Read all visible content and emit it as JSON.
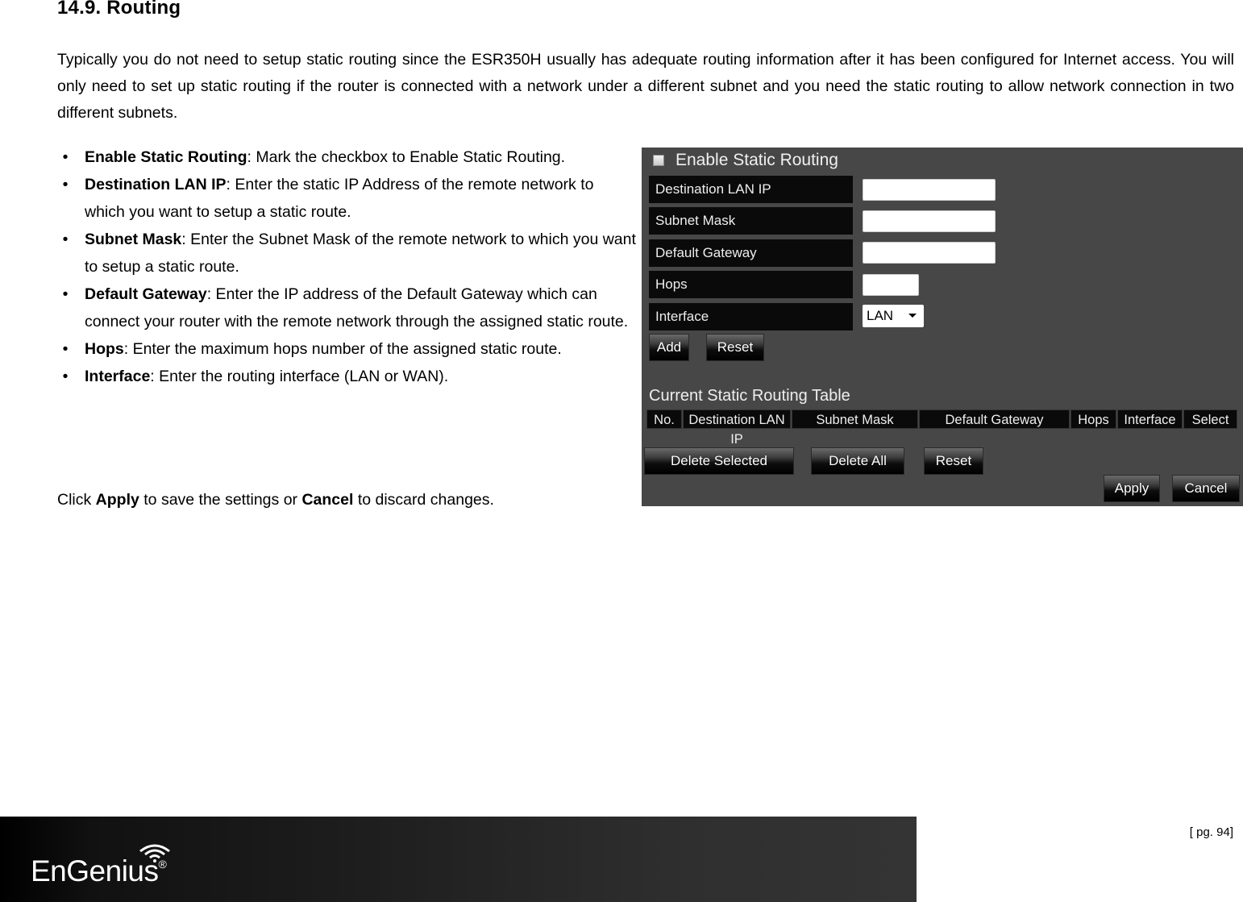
{
  "document": {
    "section_heading": "14.9.  Routing",
    "intro": "Typically you do not need to setup static routing since the ESR350H usually has adequate routing information after it has been configured for Internet access. You will only need to set up static routing if the router is connected with a network under a different subnet and you need the static routing to allow network connection in two different subnets.",
    "bullets": [
      {
        "term": "Enable Static Routing",
        "desc": ": Mark the checkbox to Enable Static Routing."
      },
      {
        "term": "Destination LAN IP",
        "desc": ": Enter the static IP Address of the remote network to which you want to setup a static route."
      },
      {
        "term": "Subnet Mask",
        "desc": ": Enter the Subnet Mask of the remote network to which you want to setup a static route."
      },
      {
        "term": "Default Gateway",
        "desc": ": Enter the IP address of the Default Gateway which can connect your router with the remote network through the assigned static route."
      },
      {
        "term": "Hops",
        "desc": ": Enter the maximum hops number of the assigned static route."
      },
      {
        "term": "Interface",
        "desc": ": Enter the routing interface (LAN or WAN)."
      }
    ],
    "closing": {
      "pre": "Click ",
      "apply": "Apply",
      "mid": " to save the settings or ",
      "cancel": "Cancel",
      "post": " to discard changes."
    },
    "bullet_glyph": "•"
  },
  "panel": {
    "enable_label": "Enable Static Routing",
    "enable_checked": false,
    "fields": [
      {
        "label": "Destination LAN IP",
        "value": ""
      },
      {
        "label": "Subnet Mask",
        "value": ""
      },
      {
        "label": "Default Gateway",
        "value": ""
      },
      {
        "label": "Hops",
        "value": ""
      }
    ],
    "interface": {
      "label": "Interface",
      "selected": "LAN"
    },
    "add_button": "Add",
    "reset_button": "Reset",
    "table_title": "Current Static Routing Table",
    "table_headers": [
      "No.",
      "Destination LAN IP",
      "Subnet Mask",
      "Default Gateway",
      "Hops",
      "Interface",
      "Select"
    ],
    "delete_selected_button": "Delete Selected",
    "delete_all_button": "Delete All",
    "table_reset_button": "Reset",
    "apply_button": "Apply",
    "cancel_button": "Cancel"
  },
  "footer": {
    "brand": "EnGenius",
    "registered": "®",
    "page": "[ pg. 94]"
  }
}
